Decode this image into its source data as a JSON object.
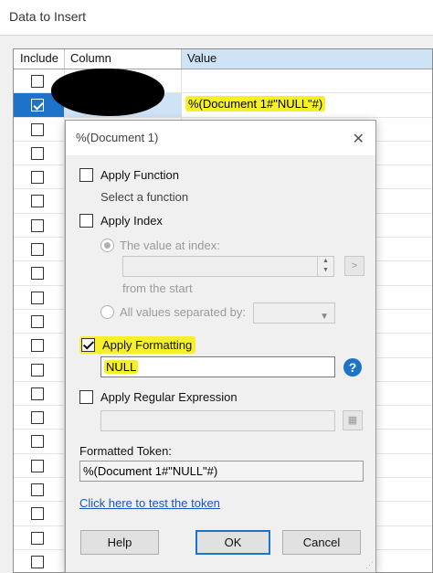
{
  "window": {
    "title": "Data to Insert"
  },
  "grid": {
    "headers": {
      "include": "Include",
      "column": "Column",
      "value": "Value"
    },
    "selected_value": "%(Document 1#\"NULL\"#)",
    "row_count": 21
  },
  "dialog": {
    "title": "%(Document 1)",
    "close_glyph": "✕",
    "apply_function": {
      "label": "Apply Function",
      "checked": false,
      "sub": "Select a function"
    },
    "apply_index": {
      "label": "Apply Index",
      "checked": false,
      "value_at_index": "The value at index:",
      "from_start": "from the  start",
      "all_values": "All values separated by:",
      "go_glyph": ">"
    },
    "apply_formatting": {
      "label": "Apply Formatting",
      "checked": true,
      "value": "NULL"
    },
    "apply_regex": {
      "label": "Apply Regular Expression",
      "checked": false
    },
    "formatted_token": {
      "label": "Formatted Token:",
      "value": "%(Document 1#\"NULL\"#)"
    },
    "test_link": "Click here to test the token",
    "buttons": {
      "help": "Help",
      "ok": "OK",
      "cancel": "Cancel"
    }
  },
  "colors": {
    "highlight": "#f5f02a",
    "selection": "#1e72c8",
    "header_value": "#cfe3f6",
    "link": "#1a55c4"
  }
}
